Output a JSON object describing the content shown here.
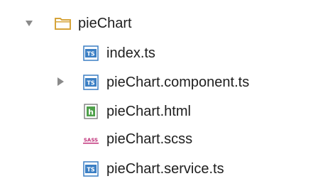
{
  "tree": {
    "folder": {
      "label": "pieChart",
      "expanded": true,
      "icon": "folder-icon",
      "icon_color": "#d6a43a"
    },
    "files": [
      {
        "label": "index.ts",
        "icon": "typescript-file-icon",
        "icon_text": "TS",
        "icon_color": "#3b7fc4",
        "expandable": false
      },
      {
        "label": "pieChart.component.ts",
        "icon": "typescript-file-icon",
        "icon_text": "TS",
        "icon_color": "#3b7fc4",
        "expandable": true,
        "expanded": false
      },
      {
        "label": "pieChart.html",
        "icon": "html-file-icon",
        "icon_text": "h",
        "icon_color": "#4ea04a",
        "expandable": false
      },
      {
        "label": "pieChart.scss",
        "icon": "sass-file-icon",
        "icon_text": "SASS",
        "icon_color": "#c0327a",
        "expandable": false
      },
      {
        "label": "pieChart.service.ts",
        "icon": "typescript-file-icon",
        "icon_text": "TS",
        "icon_color": "#3b7fc4",
        "expandable": false
      }
    ]
  }
}
